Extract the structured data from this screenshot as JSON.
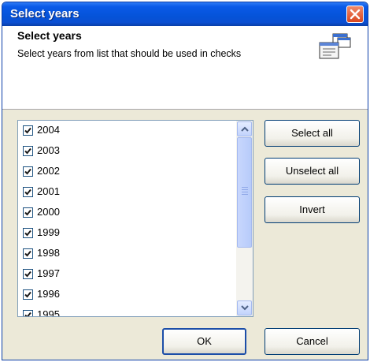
{
  "window": {
    "title": "Select years"
  },
  "header": {
    "title": "Select years",
    "description": "Select years from list that should be used in checks",
    "icon": "select-years-icon"
  },
  "years": {
    "items": [
      {
        "label": "2004",
        "checked": true
      },
      {
        "label": "2003",
        "checked": true
      },
      {
        "label": "2002",
        "checked": true
      },
      {
        "label": "2001",
        "checked": true
      },
      {
        "label": "2000",
        "checked": true
      },
      {
        "label": "1999",
        "checked": true
      },
      {
        "label": "1998",
        "checked": true
      },
      {
        "label": "1997",
        "checked": true
      },
      {
        "label": "1996",
        "checked": true
      },
      {
        "label": "1995",
        "checked": true
      }
    ]
  },
  "buttons": {
    "select_all": "Select all",
    "unselect_all": "Unselect all",
    "invert": "Invert",
    "ok": "OK",
    "cancel": "Cancel"
  },
  "colors": {
    "titlebar": "#0553d8",
    "dialog_bg": "#ece9d8",
    "close_button": "#d9461f"
  }
}
